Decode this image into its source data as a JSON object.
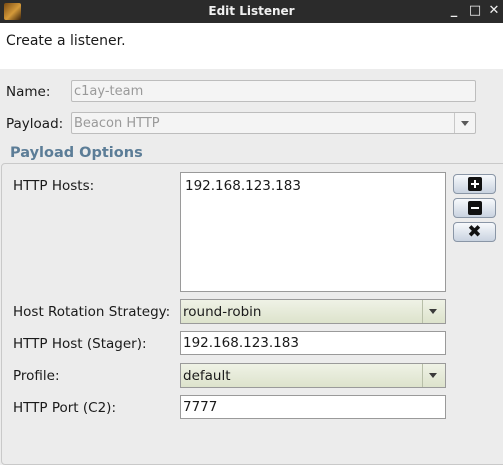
{
  "window": {
    "title": "Edit Listener",
    "controls": {
      "minimize": "_",
      "maximize": "□",
      "close": "✕"
    }
  },
  "header": {
    "description": "Create a listener."
  },
  "form": {
    "name_label": "Name:",
    "name_value": "c1ay-team",
    "payload_label": "Payload:",
    "payload_value": "Beacon HTTP"
  },
  "payload_options": {
    "title": "Payload Options",
    "http_hosts_label": "HTTP Hosts:",
    "http_hosts": [
      "192.168.123.183"
    ],
    "buttons": {
      "add_icon": "plus-icon",
      "remove_icon": "minus-icon",
      "clear_icon": "close-icon",
      "clear_glyph": "✖"
    },
    "rotation_label": "Host Rotation Strategy:",
    "rotation_value": "round-robin",
    "stager_label": "HTTP Host (Stager):",
    "stager_value": "192.168.123.183",
    "profile_label": "Profile:",
    "profile_value": "default",
    "port_label": "HTTP Port (C2):",
    "port_value": "7777"
  }
}
